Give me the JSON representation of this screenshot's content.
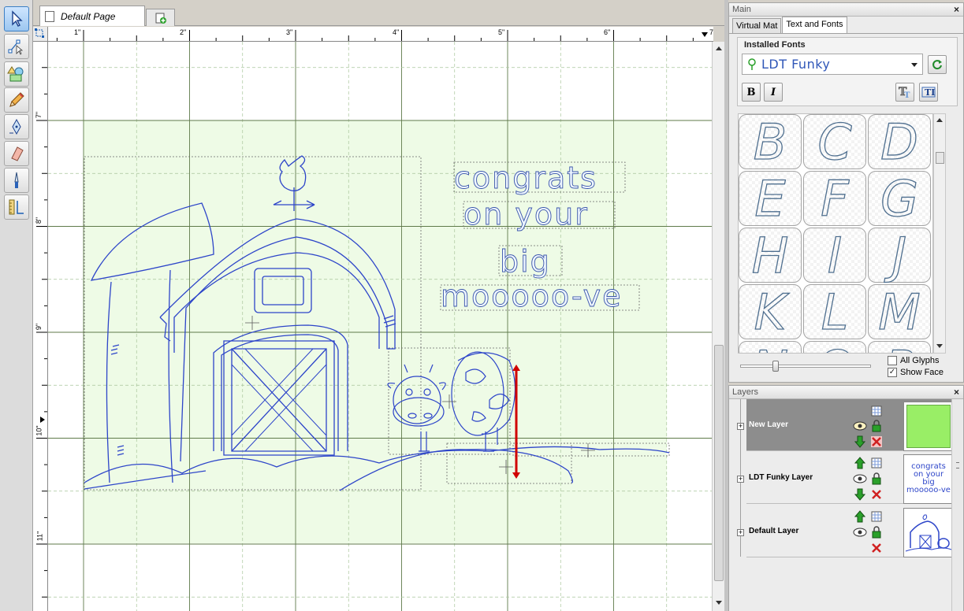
{
  "document": {
    "tab_title": "Default Page"
  },
  "toolbar": {
    "tools": [
      "select-tool",
      "node-edit-tool",
      "shapes-tool",
      "pencil-tool",
      "pen-tool",
      "eraser-tool",
      "knife-tool",
      "measure-tool"
    ]
  },
  "rulers": {
    "horizontal": [
      "1\"",
      "2\"",
      "3\"",
      "4\"",
      "5\"",
      "6\"",
      "7\""
    ],
    "vertical": [
      "7\"",
      "8\"",
      "9\"",
      "10\"",
      "11\""
    ]
  },
  "canvas": {
    "text_lines": [
      "congrats",
      "on your",
      "big",
      "mooooo-ve"
    ],
    "colors": {
      "mat": "#eefbe6",
      "cut_line": "#2d45c9",
      "grid": "#5f7a4a",
      "handle": "#d00000"
    }
  },
  "main_panel": {
    "title": "Main",
    "close": "×",
    "tabs": [
      "Virtual Mat",
      "Text and Fonts"
    ],
    "active_tab": "Text and Fonts",
    "installed_fonts_label": "Installed Fonts",
    "selected_font": "LDT Funky",
    "bold_label": "B",
    "italic_label": "I",
    "glyphs": [
      "B",
      "C",
      "D",
      "E",
      "F",
      "G",
      "H",
      "I",
      "J",
      "K",
      "L",
      "M",
      "N",
      "O",
      "P"
    ],
    "all_glyphs_label": "All Glyphs",
    "all_glyphs_checked": false,
    "show_face_label": "Show Face",
    "show_face_checked": true
  },
  "layers_panel": {
    "title": "Layers",
    "close": "×",
    "layers": [
      {
        "name": "New Layer",
        "selected": true
      },
      {
        "name": "LDT Funky Layer",
        "selected": false,
        "thumb_text": [
          "congrats",
          "on your",
          "big",
          "mooooo-ve"
        ]
      },
      {
        "name": "Default Layer",
        "selected": false
      }
    ]
  }
}
